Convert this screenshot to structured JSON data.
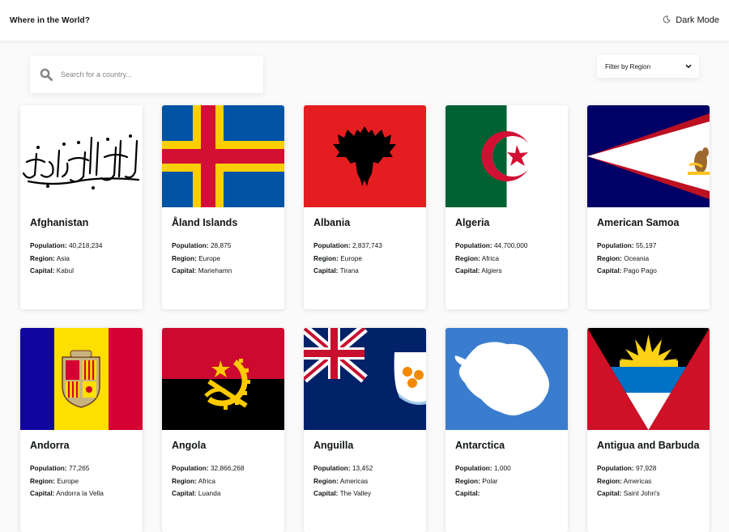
{
  "header": {
    "title": "Where in the World?",
    "dark_mode_label": "Dark Mode"
  },
  "search": {
    "placeholder": "Search for a country..."
  },
  "filter": {
    "label": "Filter by Region"
  },
  "labels": {
    "population": "Population:",
    "region": "Region:",
    "capital": "Capital:"
  },
  "countries": [
    {
      "name": "Afghanistan",
      "population": "40,218,234",
      "region": "Asia",
      "capital": "Kabul",
      "flag": "afghanistan-flag-icon"
    },
    {
      "name": "Åland Islands",
      "population": "28,875",
      "region": "Europe",
      "capital": "Mariehamn",
      "flag": "aland-flag-icon"
    },
    {
      "name": "Albania",
      "population": "2,837,743",
      "region": "Europe",
      "capital": "Tirana",
      "flag": "albania-flag-icon"
    },
    {
      "name": "Algeria",
      "population": "44,700,000",
      "region": "Africa",
      "capital": "Algiers",
      "flag": "algeria-flag-icon"
    },
    {
      "name": "American Samoa",
      "population": "55,197",
      "region": "Oceania",
      "capital": "Pago Pago",
      "flag": "american-samoa-flag-icon"
    },
    {
      "name": "Andorra",
      "population": "77,265",
      "region": "Europe",
      "capital": "Andorra la Vella",
      "flag": "andorra-flag-icon"
    },
    {
      "name": "Angola",
      "population": "32,866,268",
      "region": "Africa",
      "capital": "Luanda",
      "flag": "angola-flag-icon"
    },
    {
      "name": "Anguilla",
      "population": "13,452",
      "region": "Americas",
      "capital": "The Valley",
      "flag": "anguilla-flag-icon"
    },
    {
      "name": "Antarctica",
      "population": "1,000",
      "region": "Polar",
      "capital": "",
      "flag": "antarctica-flag-icon"
    },
    {
      "name": "Antigua and Barbuda",
      "population": "97,928",
      "region": "Americas",
      "capital": "Saint John's",
      "flag": "antigua-flag-icon"
    }
  ],
  "colors": {
    "background": "#fafafa",
    "element": "#ffffff",
    "text": "#111517",
    "placeholder": "#848484"
  }
}
